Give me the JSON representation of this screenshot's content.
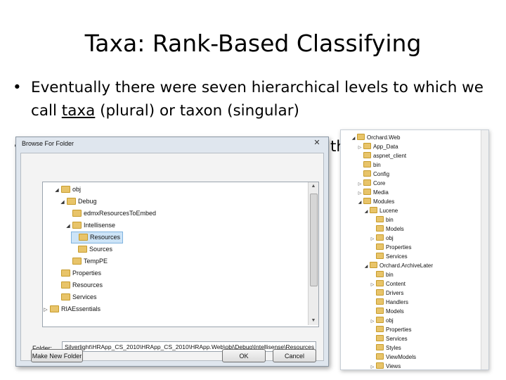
{
  "slide": {
    "title": "Taxa: Rank-Based Classifying",
    "bullet1_pre": "Eventually there were seven hierarchical levels to which we call ",
    "bullet1_u": "taxa",
    "bullet1_post": " (plural) or taxon (singular)",
    "bullet_symbol": "•",
    "bullet3_tail": "th"
  },
  "dialog": {
    "title": "Browse For Folder",
    "close_label": "✕",
    "folder_label": "Folder:",
    "folder_value": "Silverlight\\HRApp_CS_2010\\HRApp_CS_2010\\HRApp.Web\\obj\\Debug\\Intellisense\\Resources",
    "new_folder_label": "Make New Folder",
    "ok_label": "OK",
    "cancel_label": "Cancel",
    "tree": [
      {
        "label": "obj",
        "arrow": "◢"
      },
      {
        "label": "Debug",
        "arrow": "◢"
      },
      {
        "label": "edmxResourcesToEmbed",
        "arrow": ""
      },
      {
        "label": "Intellisense",
        "arrow": "◢"
      },
      {
        "label": "Resources",
        "arrow": ""
      },
      {
        "label": "Sources",
        "arrow": ""
      },
      {
        "label": "TempPE",
        "arrow": ""
      },
      {
        "label": "Properties",
        "arrow": ""
      },
      {
        "label": "Resources",
        "arrow": ""
      },
      {
        "label": "Services",
        "arrow": ""
      },
      {
        "label": "RIAEssentials",
        "arrow": "▷"
      }
    ]
  },
  "explorer": {
    "items": [
      {
        "label": "Orchard.Web",
        "arrow": "◢"
      },
      {
        "label": "App_Data",
        "arrow": "▷"
      },
      {
        "label": "aspnet_client",
        "arrow": ""
      },
      {
        "label": "bin",
        "arrow": ""
      },
      {
        "label": "Config",
        "arrow": ""
      },
      {
        "label": "Core",
        "arrow": "▷"
      },
      {
        "label": "Media",
        "arrow": "▷"
      },
      {
        "label": "Modules",
        "arrow": "◢"
      },
      {
        "label": "Lucene",
        "arrow": "◢"
      },
      {
        "label": "bin",
        "arrow": ""
      },
      {
        "label": "Models",
        "arrow": ""
      },
      {
        "label": "obj",
        "arrow": "▷"
      },
      {
        "label": "Properties",
        "arrow": ""
      },
      {
        "label": "Services",
        "arrow": ""
      },
      {
        "label": "Orchard.ArchiveLater",
        "arrow": "◢"
      },
      {
        "label": "bin",
        "arrow": ""
      },
      {
        "label": "Content",
        "arrow": "▷"
      },
      {
        "label": "Drivers",
        "arrow": ""
      },
      {
        "label": "Handlers",
        "arrow": ""
      },
      {
        "label": "Models",
        "arrow": ""
      },
      {
        "label": "obj",
        "arrow": "▷"
      },
      {
        "label": "Properties",
        "arrow": ""
      },
      {
        "label": "Services",
        "arrow": ""
      },
      {
        "label": "Styles",
        "arrow": ""
      },
      {
        "label": "ViewModels",
        "arrow": ""
      },
      {
        "label": "Views",
        "arrow": "▷"
      }
    ]
  }
}
